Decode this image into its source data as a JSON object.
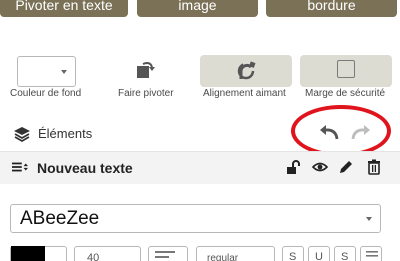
{
  "top_buttons": {
    "first_label": "Pivoter en texte",
    "second_label": "image",
    "third_label": "bordure"
  },
  "tools": {
    "background_color_label": "Couleur de fond",
    "rotate_label": "Faire pivoter",
    "magnet_label": "Alignement aimant",
    "safety_margin_label": "Marge de sécurité"
  },
  "elements": {
    "title": "Éléments"
  },
  "text_item": {
    "title": "Nouveau texte"
  },
  "font": {
    "selected": "ABeeZee"
  },
  "format_bar": {
    "size": "40",
    "weight": "regular",
    "style_s": "S",
    "style_u": "U",
    "style_strike": "S"
  },
  "colors": {
    "top_button_bg": "#7a7157",
    "toggle_bg": "#dddcd3",
    "highlight": "#e0141c"
  }
}
